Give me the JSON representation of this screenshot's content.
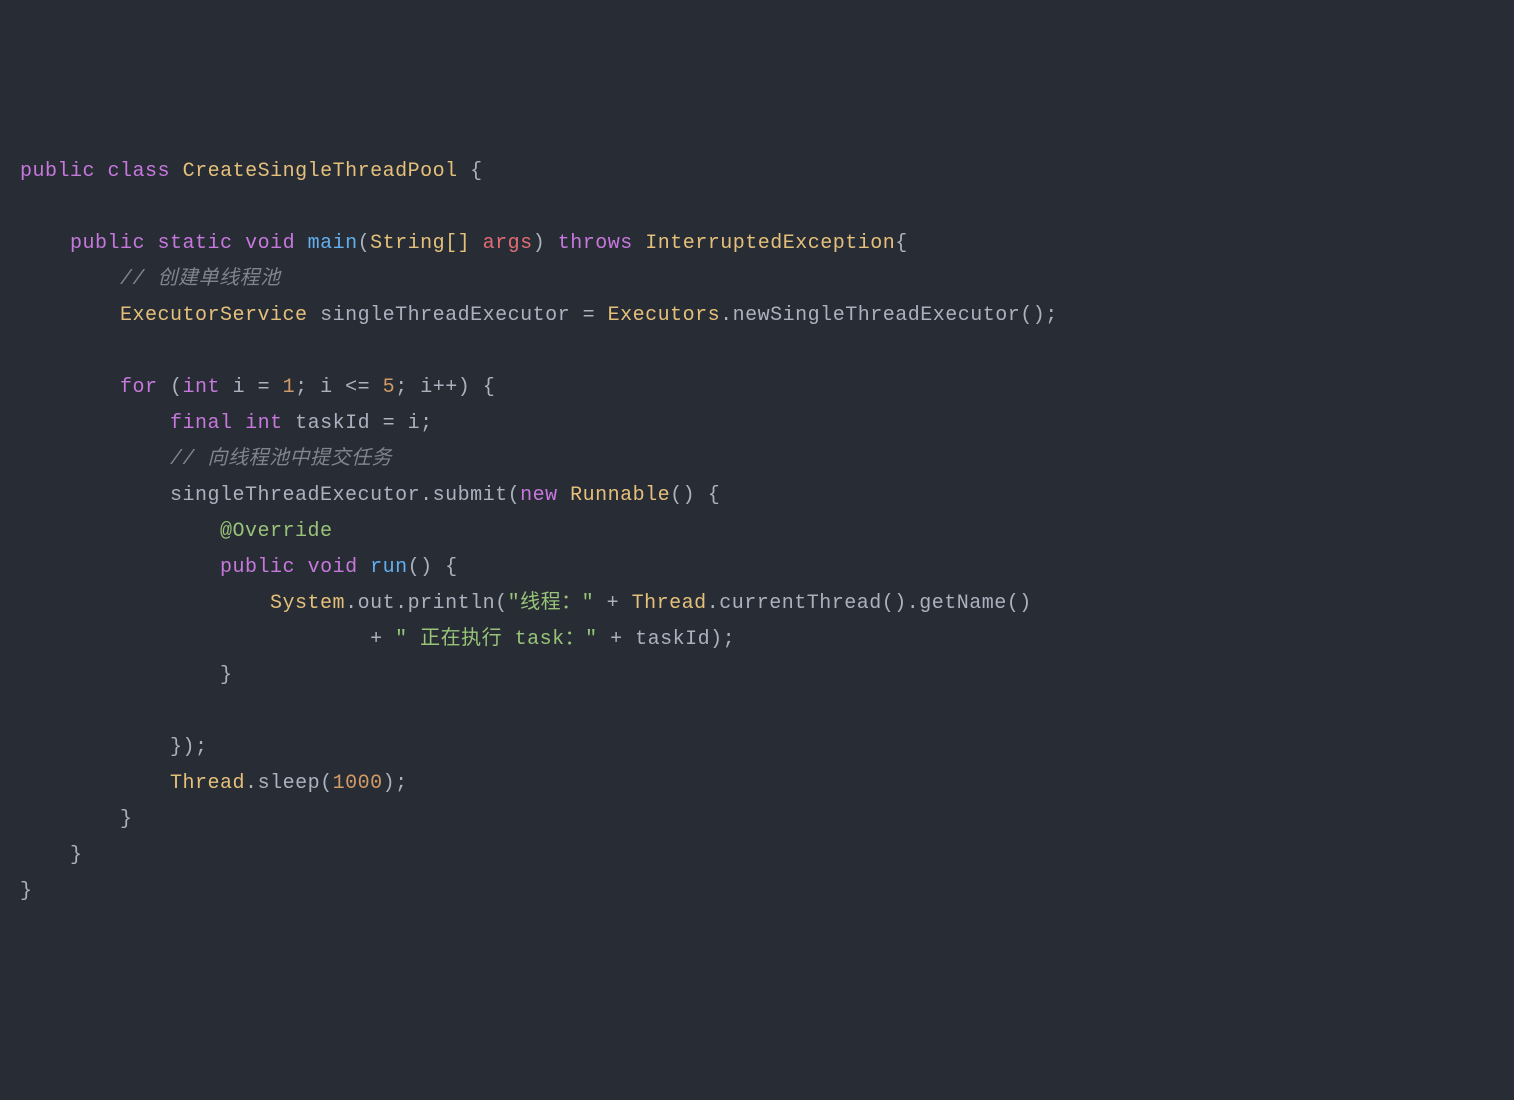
{
  "code": {
    "line1": {
      "public": "public",
      "class": "class",
      "className": "CreateSingleThreadPool",
      "brace": " {"
    },
    "line2": "",
    "line3": {
      "indent": "    ",
      "public": "public",
      "static": "static",
      "void": "void",
      "main": "main",
      "openParen": "(",
      "stringArr": "String[]",
      "args": "args",
      "closeParen": ")",
      "throws": "throws",
      "exception": "InterruptedException",
      "brace": "{"
    },
    "line4": {
      "indent": "        ",
      "comment": "// 创建单线程池"
    },
    "line5": {
      "indent": "        ",
      "type": "ExecutorService",
      "var": "singleThreadExecutor",
      "equals": " = ",
      "executors": "Executors",
      "dot": ".",
      "method": "newSingleThreadExecutor",
      "parens": "();"
    },
    "line6": "",
    "line7": {
      "indent": "        ",
      "for": "for",
      "open": " (",
      "int": "int",
      "i": "i",
      "eq": " = ",
      "one": "1",
      "semi1": "; ",
      "i2": "i",
      "lte": " <= ",
      "five": "5",
      "semi2": "; ",
      "i3": "i",
      "inc": "++",
      "close": ") {"
    },
    "line8": {
      "indent": "            ",
      "final": "final",
      "int": "int",
      "taskId": "taskId",
      "eq": " = ",
      "i": "i",
      "semi": ";"
    },
    "line9": {
      "indent": "            ",
      "comment": "// 向线程池中提交任务"
    },
    "line10": {
      "indent": "            ",
      "var": "singleThreadExecutor",
      "dot": ".",
      "submit": "submit",
      "open": "(",
      "new": "new",
      "runnable": "Runnable",
      "parens": "()",
      "brace": " {"
    },
    "line11": {
      "indent": "                ",
      "annotation": "@Override"
    },
    "line12": {
      "indent": "                ",
      "public": "public",
      "void": "void",
      "run": "run",
      "parens": "()",
      "brace": " {"
    },
    "line13": {
      "indent": "                    ",
      "system": "System",
      "dot1": ".",
      "out": "out",
      "dot2": ".",
      "println": "println",
      "open": "(",
      "str1": "\"线程：\"",
      "plus1": " + ",
      "thread": "Thread",
      "dot3": ".",
      "currentThread": "currentThread",
      "parens1": "()",
      "dot4": ".",
      "getName": "getName",
      "parens2": "()"
    },
    "line14": {
      "indent": "                            ",
      "plus1": "+ ",
      "str2": "\" 正在执行 task：\"",
      "plus2": " + ",
      "taskId": "taskId",
      "close": ");"
    },
    "line15": {
      "indent": "                ",
      "brace": "}"
    },
    "line16": "",
    "line17": {
      "indent": "            ",
      "close": "});"
    },
    "line18": {
      "indent": "            ",
      "thread": "Thread",
      "dot": ".",
      "sleep": "sleep",
      "open": "(",
      "num": "1000",
      "close": ");"
    },
    "line19": {
      "indent": "        ",
      "brace": "}"
    },
    "line20": {
      "indent": "    ",
      "brace": "}"
    },
    "line21": {
      "brace": "}"
    }
  }
}
